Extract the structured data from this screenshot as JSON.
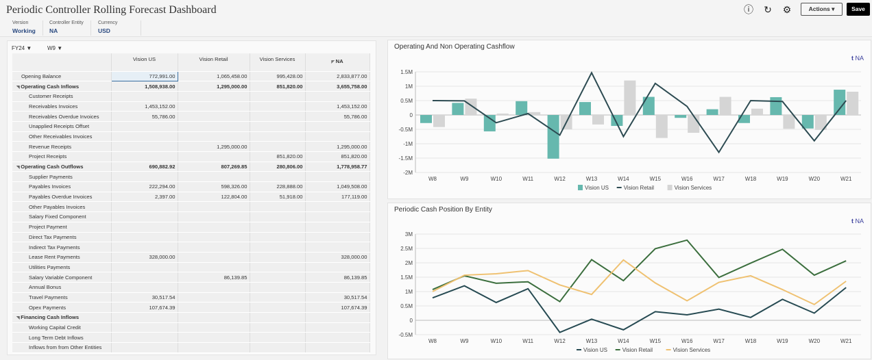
{
  "header": {
    "title": "Periodic Controller Rolling Forecast Dashboard",
    "pov": [
      {
        "label": "Version",
        "value": "Working"
      },
      {
        "label": "Controller Entity",
        "value": "NA"
      },
      {
        "label": "Currency",
        "value": "USD"
      }
    ],
    "actions_label": "Actions ▾",
    "save_label": "Save"
  },
  "grid": {
    "year": "FY24",
    "week": "W9",
    "columns": [
      "Vision US",
      "Vision Retail",
      "Vision Services",
      "NA"
    ],
    "rows": [
      {
        "label": "Opening Balance",
        "level": 1,
        "values": [
          "772,991.00",
          "1,065,458.00",
          "995,428.00",
          "2,833,877.00"
        ]
      },
      {
        "label": "Operating Cash Inflows",
        "level": 0,
        "values": [
          "1,508,938.00",
          "1,295,000.00",
          "851,820.00",
          "3,655,758.00"
        ]
      },
      {
        "label": "Customer Receipts",
        "level": 2,
        "values": [
          "",
          "",
          "",
          ""
        ]
      },
      {
        "label": "Receivables Invoices",
        "level": 2,
        "values": [
          "1,453,152.00",
          "",
          "",
          "1,453,152.00"
        ]
      },
      {
        "label": "Receivables Overdue Invoices",
        "level": 2,
        "values": [
          "55,786.00",
          "",
          "",
          "55,786.00"
        ]
      },
      {
        "label": "Unapplied Receipts Offset",
        "level": 2,
        "values": [
          "",
          "",
          "",
          ""
        ]
      },
      {
        "label": "Other Receivables Invoices",
        "level": 2,
        "values": [
          "",
          "",
          "",
          ""
        ]
      },
      {
        "label": "Revenue Receipts",
        "level": 2,
        "values": [
          "",
          "1,295,000.00",
          "",
          "1,295,000.00"
        ]
      },
      {
        "label": "Project Receipts",
        "level": 2,
        "values": [
          "",
          "",
          "851,820.00",
          "851,820.00"
        ]
      },
      {
        "label": "Operating Cash Outflows",
        "level": 0,
        "values": [
          "690,882.92",
          "807,269.85",
          "280,806.00",
          "1,778,958.77"
        ]
      },
      {
        "label": "Supplier Payments",
        "level": 2,
        "values": [
          "",
          "",
          "",
          ""
        ]
      },
      {
        "label": "Payables Invoices",
        "level": 2,
        "values": [
          "222,294.00",
          "598,326.00",
          "228,888.00",
          "1,049,508.00"
        ]
      },
      {
        "label": "Payables Overdue Invoices",
        "level": 2,
        "values": [
          "2,397.00",
          "122,804.00",
          "51,918.00",
          "177,119.00"
        ]
      },
      {
        "label": "Other Payables Invoices",
        "level": 2,
        "values": [
          "",
          "",
          "",
          ""
        ]
      },
      {
        "label": "Salary Fixed  Component",
        "level": 2,
        "values": [
          "",
          "",
          "",
          ""
        ]
      },
      {
        "label": "Project Payment",
        "level": 2,
        "values": [
          "",
          "",
          "",
          ""
        ]
      },
      {
        "label": "Direct Tax Payments",
        "level": 2,
        "values": [
          "",
          "",
          "",
          ""
        ]
      },
      {
        "label": "Indirect Tax Payments",
        "level": 2,
        "values": [
          "",
          "",
          "",
          ""
        ]
      },
      {
        "label": "Lease Rent Payments",
        "level": 2,
        "values": [
          "328,000.00",
          "",
          "",
          "328,000.00"
        ]
      },
      {
        "label": "Utilities Payments",
        "level": 2,
        "values": [
          "",
          "",
          "",
          ""
        ]
      },
      {
        "label": "Salary Variable Component",
        "level": 2,
        "values": [
          "",
          "86,139.85",
          "",
          "86,139.85"
        ]
      },
      {
        "label": "Annual Bonus",
        "level": 2,
        "values": [
          "",
          "",
          "",
          ""
        ]
      },
      {
        "label": "Travel Payments",
        "level": 2,
        "values": [
          "30,517.54",
          "",
          "",
          "30,517.54"
        ]
      },
      {
        "label": "Opex Payments",
        "level": 2,
        "values": [
          "107,674.39",
          "",
          "",
          "107,674.39"
        ]
      },
      {
        "label": "Financing Cash Inflows",
        "level": 0,
        "values": [
          "",
          "",
          "",
          ""
        ]
      },
      {
        "label": "Working Capital Credit",
        "level": 2,
        "values": [
          "",
          "",
          "",
          ""
        ]
      },
      {
        "label": "Long Term Debt Inflows",
        "level": 2,
        "values": [
          "",
          "",
          "",
          ""
        ]
      },
      {
        "label": "Inflows from from Other Entities",
        "level": 2,
        "values": [
          "",
          "",
          "",
          ""
        ]
      }
    ]
  },
  "chart_data": [
    {
      "type": "bar",
      "title": "Operating And Non Operating Cashflow",
      "filter": "NA",
      "categories": [
        "W8",
        "W9",
        "W10",
        "W11",
        "W12",
        "W13",
        "W14",
        "W15",
        "W16",
        "W17",
        "W18",
        "W19",
        "W20",
        "W21"
      ],
      "ylim": [
        -2,
        1.5
      ],
      "yticks": [
        "-2M",
        "-1.5M",
        "-1M",
        "-0.5M",
        "0",
        "0.5M",
        "1M",
        "1.5M"
      ],
      "grid": true,
      "legend": "bottom",
      "series": [
        {
          "name": "Vision US",
          "kind": "bar",
          "color": "#66b8ae",
          "values": [
            -0.28,
            0.42,
            -0.57,
            0.48,
            -1.52,
            0.45,
            -0.38,
            0.63,
            -0.1,
            0.2,
            -0.28,
            0.62,
            -0.47,
            0.88
          ]
        },
        {
          "name": "Vision Retail",
          "kind": "line",
          "color": "#2d4b52",
          "values": [
            0.5,
            0.49,
            -0.27,
            0.05,
            -0.7,
            1.47,
            -0.75,
            1.1,
            0.3,
            -1.3,
            0.5,
            0.47,
            -0.9,
            0.5
          ]
        },
        {
          "name": "Vision Services",
          "kind": "bar",
          "color": "#d5d5d5",
          "values": [
            -0.42,
            0.57,
            0.05,
            0.1,
            -0.5,
            -0.33,
            1.2,
            -0.8,
            -0.62,
            0.63,
            0.22,
            -0.48,
            -0.52,
            0.81
          ]
        }
      ]
    },
    {
      "type": "line",
      "title": "Periodic Cash Position By Entity",
      "filter": "NA",
      "categories": [
        "W8",
        "W9",
        "W10",
        "W11",
        "W12",
        "W13",
        "W14",
        "W15",
        "W16",
        "W17",
        "W18",
        "W19",
        "W20",
        "W21"
      ],
      "ylim": [
        -0.5,
        3
      ],
      "yticks": [
        "-0.5M",
        "0",
        "0.5M",
        "1M",
        "1.5M",
        "2M",
        "2.5M",
        "3M"
      ],
      "grid": true,
      "legend": "bottom",
      "series": [
        {
          "name": "Vision US",
          "kind": "line",
          "color": "#264a52",
          "values": [
            0.78,
            1.2,
            0.62,
            1.1,
            -0.42,
            0.04,
            -0.33,
            0.3,
            0.19,
            0.39,
            0.1,
            0.73,
            0.25,
            1.14
          ]
        },
        {
          "name": "Vision Retail",
          "kind": "line",
          "color": "#3b6e3d",
          "values": [
            1.07,
            1.55,
            1.29,
            1.34,
            0.65,
            2.11,
            1.38,
            2.49,
            2.79,
            1.49,
            1.99,
            2.47,
            1.57,
            2.07
          ]
        },
        {
          "name": "Vision Services",
          "kind": "line",
          "color": "#efc171",
          "values": [
            1.0,
            1.57,
            1.62,
            1.73,
            1.23,
            0.9,
            2.1,
            1.3,
            0.68,
            1.32,
            1.55,
            1.07,
            0.55,
            1.36
          ]
        }
      ]
    }
  ]
}
